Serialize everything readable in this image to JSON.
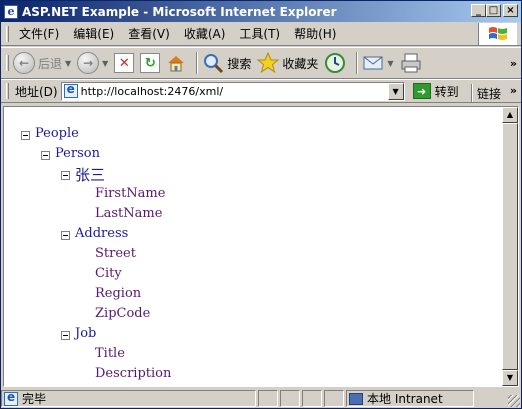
{
  "window": {
    "title": "ASP.NET Example - Microsoft Internet Explorer",
    "buttons": {
      "minimize": "_",
      "maximize": "□",
      "close": "×"
    }
  },
  "menubar": {
    "items": [
      "文件(F)",
      "编辑(E)",
      "查看(V)",
      "收藏(A)",
      "工具(T)",
      "帮助(H)"
    ]
  },
  "toolbar": {
    "back_label": "后退",
    "search_label": "搜索",
    "favorites_label": "收藏夹",
    "icons": [
      "back-icon",
      "forward-icon",
      "stop-icon",
      "refresh-icon",
      "home-icon",
      "search-icon",
      "favorites-icon",
      "history-icon",
      "mail-icon",
      "print-icon"
    ]
  },
  "addressbar": {
    "label": "地址(D)",
    "url": "http://localhost:2476/xml/",
    "go_label": "转到",
    "links_label": "链接"
  },
  "xml_tree": {
    "people": "People",
    "person": "Person",
    "name": "张三",
    "first_name": "FirstName",
    "last_name": "LastName",
    "address": "Address",
    "street": "Street",
    "city": "City",
    "region": "Region",
    "zip": "ZipCode",
    "job": "Job",
    "title": "Title",
    "description": "Description"
  },
  "statusbar": {
    "status": "完毕",
    "zone": "本地 Intranet"
  },
  "colors": {
    "titlebar_start": "#0a246a",
    "titlebar_end": "#a6caf0",
    "branch_node": "#1b1b9a",
    "leaf_node": "#5a1770",
    "chrome": "#d4d0c8"
  }
}
